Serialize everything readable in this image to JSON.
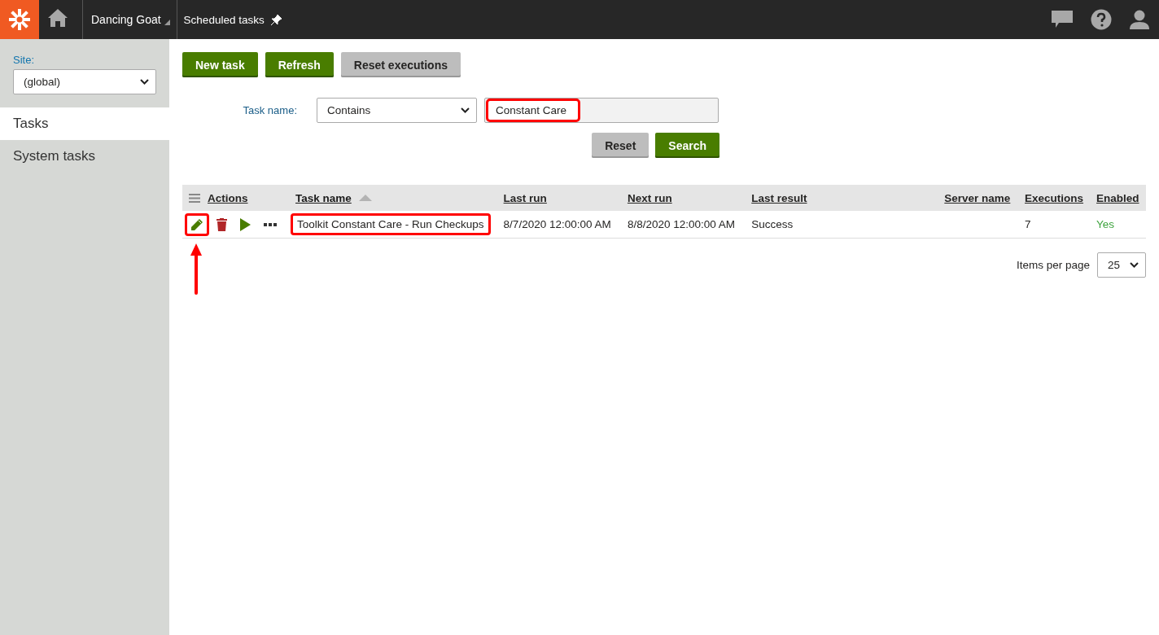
{
  "header": {
    "site": "Dancing Goat",
    "page": "Scheduled tasks"
  },
  "sidebar": {
    "site_label": "Site:",
    "site_value": "(global)",
    "items": [
      {
        "label": "Tasks",
        "selected": true
      },
      {
        "label": "System tasks",
        "selected": false
      }
    ]
  },
  "toolbar": [
    {
      "label": "New task",
      "kind": "primary"
    },
    {
      "label": "Refresh",
      "kind": "primary"
    },
    {
      "label": "Reset executions",
      "kind": "secondary"
    }
  ],
  "filter": {
    "label": "Task name:",
    "operator": "Contains",
    "value": "Constant Care",
    "highlighted": true,
    "buttons": [
      {
        "label": "Reset",
        "kind": "secondary"
      },
      {
        "label": "Search",
        "kind": "primary"
      }
    ]
  },
  "table": {
    "columns": [
      {
        "label": "Actions",
        "sorted": false
      },
      {
        "label": "Task name",
        "sorted": true
      },
      {
        "label": "Last run",
        "sorted": false
      },
      {
        "label": "Next run",
        "sorted": false
      },
      {
        "label": "Last result",
        "sorted": false
      },
      {
        "label": "Server name",
        "sorted": false
      },
      {
        "label": "Executions",
        "sorted": false
      },
      {
        "label": "Enabled",
        "sorted": false
      }
    ],
    "rows": [
      {
        "actions": [
          {
            "kind": "edit",
            "highlighted": true,
            "pointer": true
          },
          {
            "kind": "delete",
            "highlighted": false
          },
          {
            "kind": "run",
            "highlighted": false
          },
          {
            "kind": "more",
            "highlighted": false
          }
        ],
        "task_name": "Toolkit Constant Care - Run Checkups",
        "task_name_highlighted": true,
        "last_run": "8/7/2020 12:00:00 AM",
        "next_run": "8/8/2020 12:00:00 AM",
        "last_result": "Success",
        "executions": "7",
        "enabled_text": "Yes",
        "enabled": true
      }
    ]
  },
  "pager": {
    "label": "Items per page",
    "value": "25"
  }
}
